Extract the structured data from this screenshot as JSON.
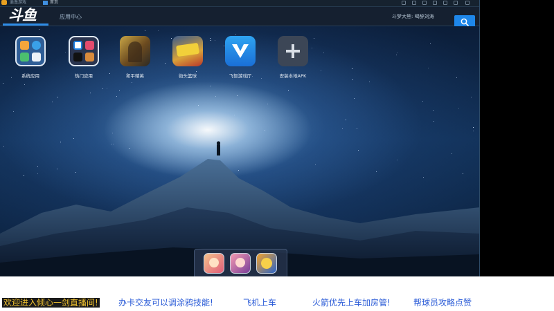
{
  "titlebar": {
    "app_title": "逍遥游戏",
    "home_tab": "首页"
  },
  "topbar": {
    "logo_text": "斗鱼",
    "app_center_label": "应用中心",
    "user_label": "斗梦大熊:  喝醉刘涛"
  },
  "desktop": {
    "apps": [
      {
        "label": "系统应用",
        "icon": "system-apps-folder-icon"
      },
      {
        "label": "热门应用",
        "icon": "popular-apps-folder-icon"
      },
      {
        "label": "和平精英",
        "icon": "peace-elite-game-icon"
      },
      {
        "label": "街头篮球",
        "icon": "street-basketball-game-icon"
      },
      {
        "label": "飞智游戏厅",
        "icon": "feizhi-game-hall-icon"
      },
      {
        "label": "安装本地APK",
        "icon": "add-plus-icon"
      }
    ],
    "dock": [
      {
        "icon": "dock-game-1-icon"
      },
      {
        "icon": "dock-game-2-icon"
      },
      {
        "icon": "dock-game-3-icon"
      }
    ]
  },
  "ticker": {
    "items": [
      "欢迎进入倾心一剑直播间!",
      "办卡交友可以调涂鸦技能!",
      "飞机上车",
      "火箭优先上车加房管!",
      "帮球员攻略点赞"
    ]
  },
  "colors": {
    "accent": "#1e87ea",
    "ticker_text": "#2a5bd7",
    "ticker_highlight": "#f2c330"
  }
}
